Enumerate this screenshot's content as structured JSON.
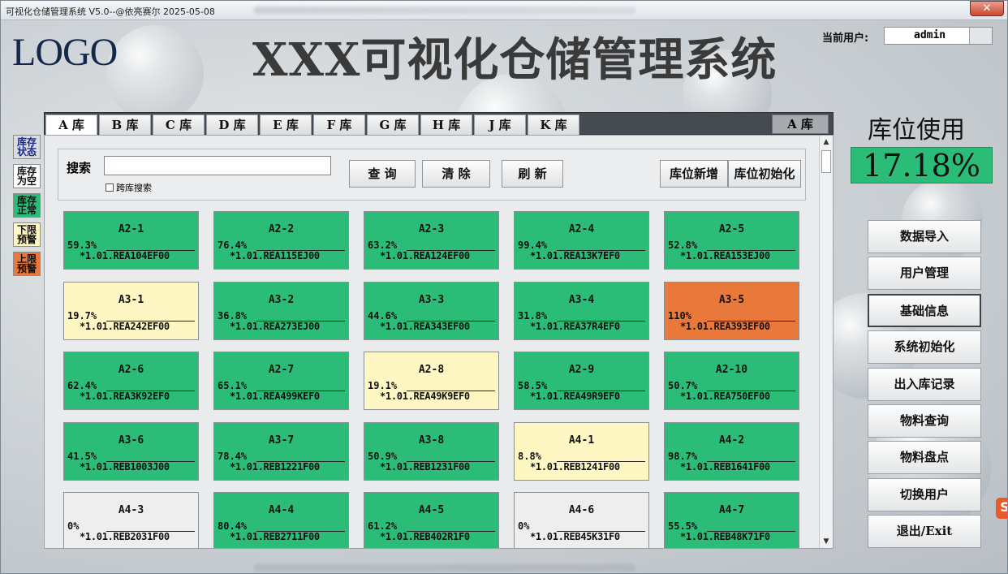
{
  "window": {
    "title": "可视化仓储管理系统 V5.0--@依亮赛尔 2025-05-08",
    "close_label": "✕"
  },
  "header": {
    "logo": "LOGO",
    "app_title": "XXX可视化仓储管理系统",
    "user_label": "当前用户:",
    "user_value": "admin"
  },
  "legend": [
    {
      "label": "库存状态",
      "color": "#dcdcdc",
      "text_color": "#1a2a8a"
    },
    {
      "label": "库存为空",
      "color": "#ffffff",
      "text_color": "#111111"
    },
    {
      "label": "库存正常",
      "color": "#2bbd78",
      "text_color": "#111111"
    },
    {
      "label": "下限预警",
      "color": "#fef7c3",
      "text_color": "#111111"
    },
    {
      "label": "上限预警",
      "color": "#e8793a",
      "text_color": "#111111"
    }
  ],
  "tabs": [
    "A 库",
    "B 库",
    "C 库",
    "D 库",
    "E 库",
    "F 库",
    "G 库",
    "H 库",
    "J 库",
    "K 库"
  ],
  "current_tab": "A 库",
  "search": {
    "label": "搜索",
    "value": "",
    "cross_label": "跨库搜索",
    "query_label": "查 询",
    "clear_label": "清 除",
    "refresh_label": "刷 新",
    "add_label": "库位新增",
    "init_label": "库位初始化"
  },
  "slots": [
    {
      "id": "A2-1",
      "pct": "59.3%",
      "code": "*1.01.REA104EF00",
      "status": "green"
    },
    {
      "id": "A2-2",
      "pct": "76.4%",
      "code": "*1.01.REA115EJ00",
      "status": "green"
    },
    {
      "id": "A2-3",
      "pct": "63.2%",
      "code": "*1.01.REA124EF00",
      "status": "green"
    },
    {
      "id": "A2-4",
      "pct": "99.4%",
      "code": "*1.01.REA13K7EF0",
      "status": "green"
    },
    {
      "id": "A2-5",
      "pct": "52.8%",
      "code": "*1.01.REA153EJ00",
      "status": "green"
    },
    {
      "id": "A3-1",
      "pct": "19.7%",
      "code": "*1.01.REA242EF00",
      "status": "yellow"
    },
    {
      "id": "A3-2",
      "pct": "36.8%",
      "code": "*1.01.REA273EJ00",
      "status": "green"
    },
    {
      "id": "A3-3",
      "pct": "44.6%",
      "code": "*1.01.REA343EF00",
      "status": "green"
    },
    {
      "id": "A3-4",
      "pct": "31.8%",
      "code": "*1.01.REA37R4EF0",
      "status": "green"
    },
    {
      "id": "A3-5",
      "pct": "110%",
      "code": "*1.01.REA393EF00",
      "status": "orange"
    },
    {
      "id": "A2-6",
      "pct": "62.4%",
      "code": "*1.01.REA3K92EF0",
      "status": "green"
    },
    {
      "id": "A2-7",
      "pct": "65.1%",
      "code": "*1.01.REA499KEF0",
      "status": "green"
    },
    {
      "id": "A2-8",
      "pct": "19.1%",
      "code": "*1.01.REA49K9EF0",
      "status": "yellow"
    },
    {
      "id": "A2-9",
      "pct": "58.5%",
      "code": "*1.01.REA49R9EF0",
      "status": "green"
    },
    {
      "id": "A2-10",
      "pct": "50.7%",
      "code": "*1.01.REA750EF00",
      "status": "green"
    },
    {
      "id": "A3-6",
      "pct": "41.5%",
      "code": "*1.01.REB1003J00",
      "status": "green"
    },
    {
      "id": "A3-7",
      "pct": "78.4%",
      "code": "*1.01.REB1221F00",
      "status": "green"
    },
    {
      "id": "A3-8",
      "pct": "50.9%",
      "code": "*1.01.REB1231F00",
      "status": "green"
    },
    {
      "id": "A4-1",
      "pct": "8.8%",
      "code": "*1.01.REB1241F00",
      "status": "yellow"
    },
    {
      "id": "A4-2",
      "pct": "98.7%",
      "code": "*1.01.REB1641F00",
      "status": "green"
    },
    {
      "id": "A4-3",
      "pct": "0%",
      "code": "*1.01.REB2031F00",
      "status": "grey"
    },
    {
      "id": "A4-4",
      "pct": "80.4%",
      "code": "*1.01.REB2711F00",
      "status": "green"
    },
    {
      "id": "A4-5",
      "pct": "61.2%",
      "code": "*1.01.REB402R1F0",
      "status": "green"
    },
    {
      "id": "A4-6",
      "pct": "0%",
      "code": "*1.01.REB45K31F0",
      "status": "grey"
    },
    {
      "id": "A4-7",
      "pct": "55.5%",
      "code": "*1.01.REB48K71F0",
      "status": "green"
    }
  ],
  "usage": {
    "title": "库位使用",
    "value": "17.18%"
  },
  "side_buttons": [
    {
      "label": "数据导入",
      "active": false
    },
    {
      "label": "用户管理",
      "active": false
    },
    {
      "label": "基础信息",
      "active": true
    },
    {
      "label": "系统初始化",
      "active": false
    },
    {
      "label": "出入库记录",
      "active": false
    },
    {
      "label": "物料查询",
      "active": false
    },
    {
      "label": "物料盘点",
      "active": false
    },
    {
      "label": "切换用户",
      "active": false
    },
    {
      "label": "退出/Exit",
      "active": false
    }
  ],
  "colors": {
    "green": "#2bbd78",
    "yellow": "#fef7c3",
    "orange": "#e8793a",
    "grey": "#eeeeee"
  }
}
